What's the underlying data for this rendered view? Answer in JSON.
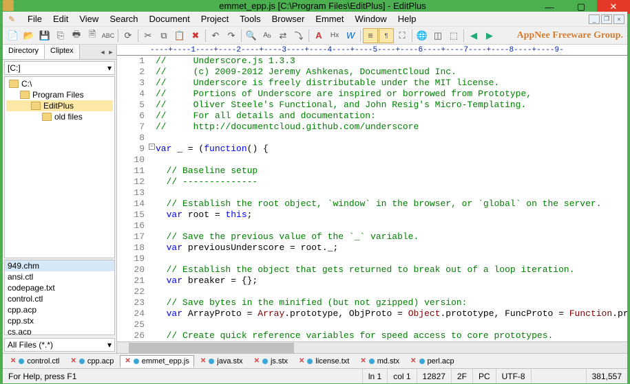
{
  "window": {
    "title": "emmet_epp.js [C:\\Program Files\\EditPlus] - EditPlus"
  },
  "menu": {
    "items": [
      "File",
      "Edit",
      "View",
      "Search",
      "Document",
      "Project",
      "Tools",
      "Browser",
      "Emmet",
      "Window",
      "Help"
    ]
  },
  "brand": "AppNee Freeware Group.",
  "sidebar": {
    "tabs": [
      "Directory",
      "Cliptex"
    ],
    "drive": "[C:]",
    "tree": [
      {
        "label": "C:\\",
        "indent": 0,
        "selected": false
      },
      {
        "label": "Program Files",
        "indent": 1,
        "selected": false
      },
      {
        "label": "EditPlus",
        "indent": 2,
        "selected": true
      },
      {
        "label": "old files",
        "indent": 3,
        "selected": false
      }
    ],
    "files": [
      "949.chm",
      "ansi.ctl",
      "codepage.txt",
      "control.ctl",
      "cpp.acp",
      "cpp.stx",
      "cs.acp"
    ],
    "filter": "All Files (*.*)"
  },
  "ruler": "----+----1----+----2----+----3----+----4----+----5----+----6----+----7----+----8----+----9-",
  "code": {
    "lines": [
      {
        "n": 1,
        "h": "<span class='c-comment'>//     Underscore.js 1.3.3</span>"
      },
      {
        "n": 2,
        "h": "<span class='c-comment'>//     (c) 2009-2012 Jeremy Ashkenas, DocumentCloud Inc.</span>"
      },
      {
        "n": 3,
        "h": "<span class='c-comment'>//     Underscore is freely distributable under the MIT license.</span>"
      },
      {
        "n": 4,
        "h": "<span class='c-comment'>//     Portions of Underscore are inspired or borrowed from Prototype,</span>"
      },
      {
        "n": 5,
        "h": "<span class='c-comment'>//     Oliver Steele's Functional, and John Resig's Micro-Templating.</span>"
      },
      {
        "n": 6,
        "h": "<span class='c-comment'>//     For all details and documentation:</span>"
      },
      {
        "n": 7,
        "h": "<span class='c-comment'>//     http://documentcloud.github.com/underscore</span>"
      },
      {
        "n": 8,
        "h": ""
      },
      {
        "n": 9,
        "h": "<span class='c-keyword'>var</span> _ = (<span class='c-keyword'>function</span>() {"
      },
      {
        "n": 10,
        "h": ""
      },
      {
        "n": 11,
        "h": "  <span class='c-comment'>// Baseline setup</span>"
      },
      {
        "n": 12,
        "h": "  <span class='c-comment'>// --------------</span>"
      },
      {
        "n": 13,
        "h": ""
      },
      {
        "n": 14,
        "h": "  <span class='c-comment'>// Establish the root object, `window` in the browser, or `global` on the server.</span>"
      },
      {
        "n": 15,
        "h": "  <span class='c-keyword'>var</span> root = <span class='c-keyword'>this</span>;"
      },
      {
        "n": 16,
        "h": ""
      },
      {
        "n": 17,
        "h": "  <span class='c-comment'>// Save the previous value of the `_` variable.</span>"
      },
      {
        "n": 18,
        "h": "  <span class='c-keyword'>var</span> previousUnderscore = root._;"
      },
      {
        "n": 19,
        "h": ""
      },
      {
        "n": 20,
        "h": "  <span class='c-comment'>// Establish the object that gets returned to break out of a loop iteration.</span>"
      },
      {
        "n": 21,
        "h": "  <span class='c-keyword'>var</span> breaker = {};"
      },
      {
        "n": 22,
        "h": ""
      },
      {
        "n": 23,
        "h": "  <span class='c-comment'>// Save bytes in the minified (but not gzipped) version:</span>"
      },
      {
        "n": 24,
        "h": "  <span class='c-keyword'>var</span> ArrayProto = <span class='c-builtin'>Array</span>.prototype, ObjProto = <span class='c-builtin'>Object</span>.prototype, FuncProto = <span class='c-builtin'>Function</span>.prototype;"
      },
      {
        "n": 25,
        "h": ""
      },
      {
        "n": 26,
        "h": "  <span class='c-comment'>// Create quick reference variables for speed access to core prototypes.</span>"
      }
    ]
  },
  "doctabs": [
    {
      "label": "control.ctl",
      "active": false
    },
    {
      "label": "cpp.acp",
      "active": false
    },
    {
      "label": "emmet_epp.js",
      "active": true
    },
    {
      "label": "java.stx",
      "active": false
    },
    {
      "label": "js.stx",
      "active": false
    },
    {
      "label": "license.txt",
      "active": false
    },
    {
      "label": "md.stx",
      "active": false
    },
    {
      "label": "perl.acp",
      "active": false
    }
  ],
  "status": {
    "help": "For Help, press F1",
    "line": "ln 1",
    "col": "col 1",
    "chars": "12827",
    "code": "2F",
    "mode": "PC",
    "encoding": "UTF-8",
    "size": "381,557"
  }
}
